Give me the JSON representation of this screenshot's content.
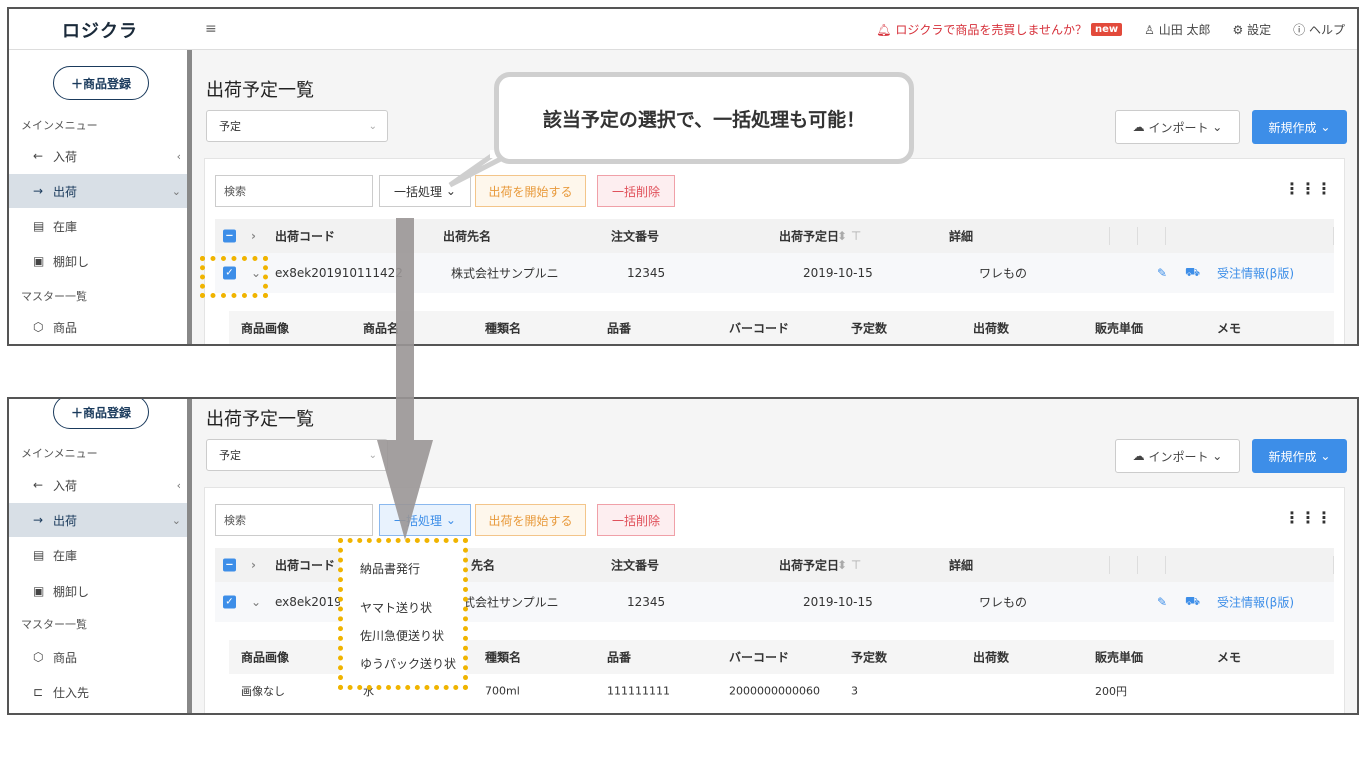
{
  "header": {
    "logo": "ロジクラ",
    "menu_icon": "hamburger-icon",
    "promo_text": "ロジクラで商品を売買しませんか？",
    "promo_badge": "new",
    "user_name": "山田 太郎",
    "settings_label": "設定",
    "help_label": "ヘルプ"
  },
  "sidebar": {
    "register_button": "＋商品登録",
    "main_menu_label": "メインメニュー",
    "items": [
      {
        "label": "入荷",
        "icon": "←"
      },
      {
        "label": "出荷",
        "icon": "→"
      },
      {
        "label": "在庫",
        "icon": "▤"
      },
      {
        "label": "棚卸し",
        "icon": "▣"
      }
    ],
    "master_label": "マスター一覧",
    "master_items": [
      {
        "label": "商品",
        "icon": "⬡"
      },
      {
        "label": "仕入先",
        "icon": "⊏"
      }
    ]
  },
  "main": {
    "page_title": "出荷予定一覧",
    "status_select": "予定",
    "import_button": "インポート",
    "new_button": "新規作成",
    "search_placeholder": "検索",
    "bulk_button": "一括処理",
    "start_button": "出荷を開始する",
    "delete_button": "一括削除",
    "columns": {
      "code": "出荷コード",
      "destination": "出荷先名",
      "order_no": "注文番号",
      "date": "出荷予定日",
      "detail": "詳細"
    },
    "row": {
      "code": "ex8ek201910111422",
      "code_short": "ex8ek201910",
      "destination": "株式会社サンプルニ",
      "destination_partial": "式会社サンプルニ",
      "order_no": "12345",
      "date": "2019-10-15",
      "detail": "ワレもの",
      "link": "受注情報(β版)"
    },
    "sub_columns": [
      "商品画像",
      "商品名",
      "種類名",
      "品番",
      "バーコード",
      "予定数",
      "出荷数",
      "販売単価",
      "メモ"
    ],
    "sub_row": {
      "image": "画像なし",
      "name": "水",
      "variant": "700ml",
      "sku": "111111111",
      "barcode": "2000000000060",
      "planned": "3",
      "price": "200円"
    }
  },
  "callout_text": "該当予定の選択で、一括処理も可能！",
  "dropdown_items": [
    "納品書発行",
    "ヤマト送り状",
    "佐川急便送り状",
    "ゆうパック送り状"
  ],
  "col_partial_destination": "先名"
}
